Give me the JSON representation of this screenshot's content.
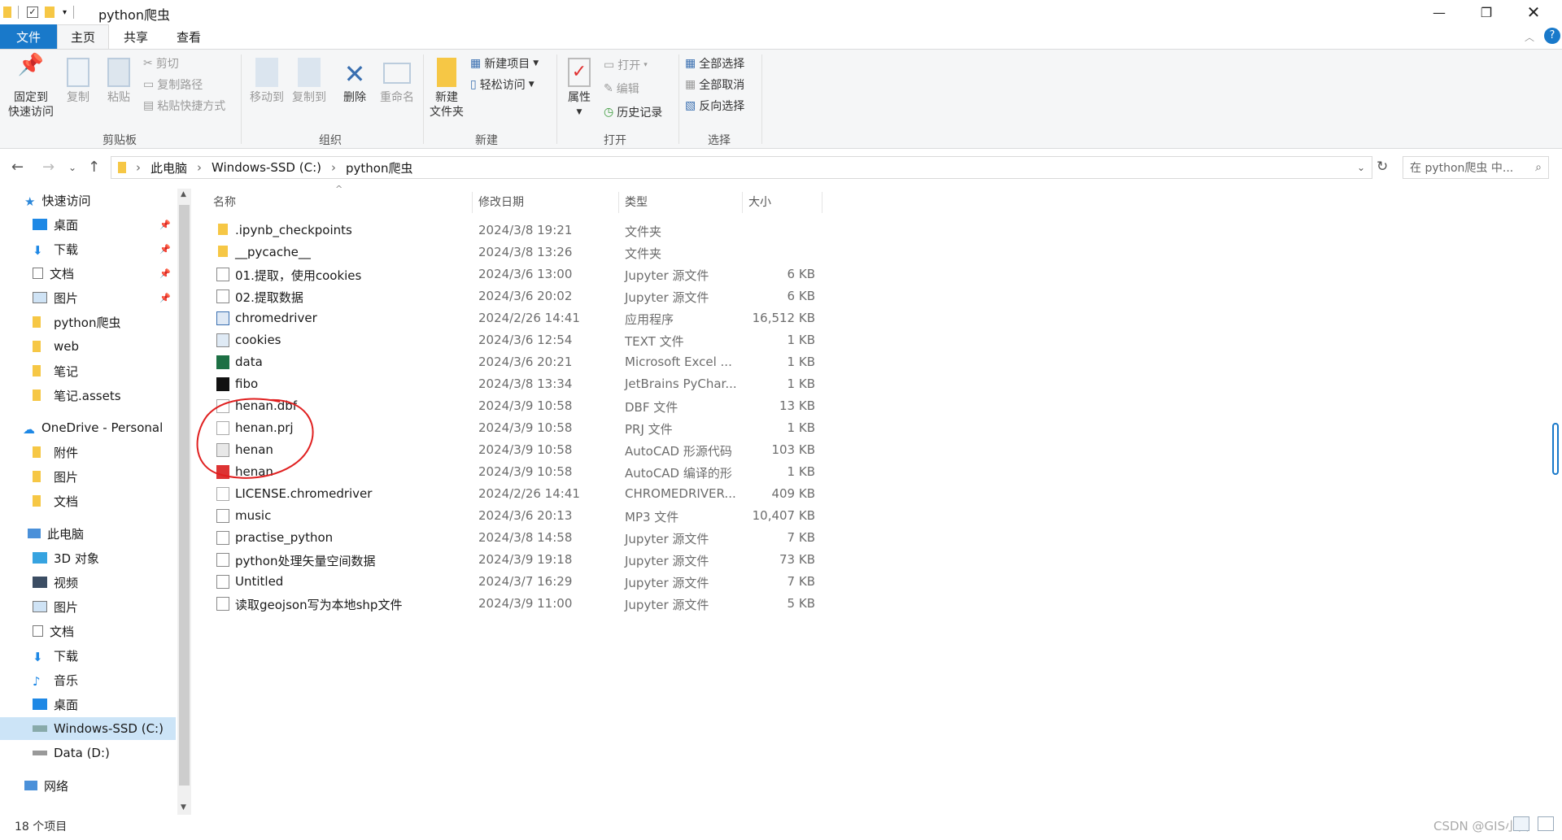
{
  "window": {
    "title": "python爬虫",
    "min_icon": "minimize-icon",
    "max_icon": "restore-icon",
    "close_icon": "close-icon"
  },
  "tabs": [
    "文件",
    "主页",
    "共享",
    "查看"
  ],
  "ribbon": {
    "clipboard": {
      "label": "剪贴板",
      "pin": "固定到\n快速访问",
      "copy": "复制",
      "paste": "粘贴",
      "cut": "剪切",
      "copy_path": "复制路径",
      "paste_shortcut": "粘贴快捷方式"
    },
    "organize": {
      "label": "组织",
      "move_to": "移动到",
      "copy_to": "复制到",
      "delete": "删除",
      "rename": "重命名"
    },
    "new": {
      "label": "新建",
      "new_folder": "新建\n文件夹",
      "new_item": "新建项目",
      "easy_access": "轻松访问"
    },
    "open": {
      "label": "打开",
      "properties": "属性",
      "open": "打开",
      "edit": "编辑",
      "history": "历史记录"
    },
    "select": {
      "label": "选择",
      "select_all": "全部选择",
      "select_none": "全部取消",
      "invert": "反向选择"
    }
  },
  "address": {
    "crumbs": [
      "此电脑",
      "Windows-SSD (C:)",
      "python爬虫"
    ],
    "search_placeholder": "在 python爬虫 中..."
  },
  "nav": {
    "quick_access": "快速访问",
    "quick_items": [
      "桌面",
      "下载",
      "文档",
      "图片",
      "python爬虫",
      "web",
      "笔记",
      "笔记.assets"
    ],
    "onedrive": "OneDrive - Personal",
    "onedrive_items": [
      "附件",
      "图片",
      "文档"
    ],
    "this_pc": "此电脑",
    "pc_items": [
      "3D 对象",
      "视频",
      "图片",
      "文档",
      "下载",
      "音乐",
      "桌面",
      "Windows-SSD (C:)",
      "Data (D:)"
    ],
    "network": "网络"
  },
  "columns": {
    "name": "名称",
    "date": "修改日期",
    "type": "类型",
    "size": "大小"
  },
  "files": [
    {
      "name": ".ipynb_checkpoints",
      "date": "2024/3/8 19:21",
      "type": "文件夹",
      "size": "",
      "icon": "folder-icon"
    },
    {
      "name": "__pycache__",
      "date": "2024/3/8 13:26",
      "type": "文件夹",
      "size": "",
      "icon": "folder-icon"
    },
    {
      "name": "01.提取，使用cookies",
      "date": "2024/3/6 13:00",
      "type": "Jupyter 源文件",
      "size": "6 KB",
      "icon": "file-icon"
    },
    {
      "name": "02.提取数据",
      "date": "2024/3/6 20:02",
      "type": "Jupyter 源文件",
      "size": "6 KB",
      "icon": "file-icon"
    },
    {
      "name": "chromedriver",
      "date": "2024/2/26 14:41",
      "type": "应用程序",
      "size": "16,512 KB",
      "icon": "exe-icon"
    },
    {
      "name": "cookies",
      "date": "2024/3/6 12:54",
      "type": "TEXT 文件",
      "size": "1 KB",
      "icon": "text-file-icon"
    },
    {
      "name": "data",
      "date": "2024/3/6 20:21",
      "type": "Microsoft Excel ...",
      "size": "1 KB",
      "icon": "excel-icon"
    },
    {
      "name": "fibo",
      "date": "2024/3/8 13:34",
      "type": "JetBrains PyChar...",
      "size": "1 KB",
      "icon": "pycharm-icon"
    },
    {
      "name": "henan.dbf",
      "date": "2024/3/9 10:58",
      "type": "DBF 文件",
      "size": "13 KB",
      "icon": "blank-file-icon"
    },
    {
      "name": "henan.prj",
      "date": "2024/3/9 10:58",
      "type": "PRJ 文件",
      "size": "1 KB",
      "icon": "blank-file-icon"
    },
    {
      "name": "henan",
      "date": "2024/3/9 10:58",
      "type": "AutoCAD 形源代码",
      "size": "103 KB",
      "icon": "autocad-shape-icon"
    },
    {
      "name": "henan",
      "date": "2024/3/9 10:58",
      "type": "AutoCAD 编译的形",
      "size": "1 KB",
      "icon": "autocad-icon"
    },
    {
      "name": "LICENSE.chromedriver",
      "date": "2024/2/26 14:41",
      "type": "CHROMEDRIVER...",
      "size": "409 KB",
      "icon": "blank-file-icon"
    },
    {
      "name": "music",
      "date": "2024/3/6 20:13",
      "type": "MP3 文件",
      "size": "10,407 KB",
      "icon": "audio-file-icon"
    },
    {
      "name": "practise_python",
      "date": "2024/3/8 14:58",
      "type": "Jupyter 源文件",
      "size": "7 KB",
      "icon": "file-icon"
    },
    {
      "name": "python处理矢量空间数据",
      "date": "2024/3/9 19:18",
      "type": "Jupyter 源文件",
      "size": "73 KB",
      "icon": "file-icon"
    },
    {
      "name": "Untitled",
      "date": "2024/3/7 16:29",
      "type": "Jupyter 源文件",
      "size": "7 KB",
      "icon": "file-icon"
    },
    {
      "name": "读取geojson写为本地shp文件",
      "date": "2024/3/9 11:00",
      "type": "Jupyter 源文件",
      "size": "5 KB",
      "icon": "file-icon"
    }
  ],
  "status": "18 个项目",
  "watermark": "CSDN @GIS小白",
  "colors": {
    "accent": "#1979ca",
    "folder": "#f6c745",
    "annotation": "#e02020"
  }
}
